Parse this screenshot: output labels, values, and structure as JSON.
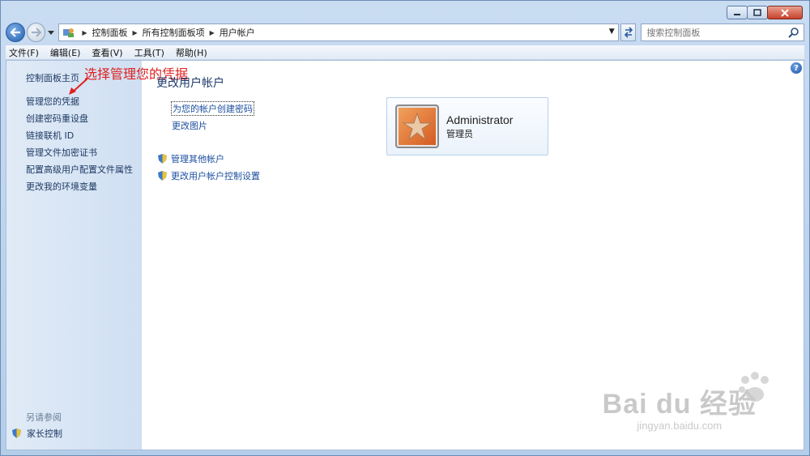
{
  "breadcrumb": [
    "控制面板",
    "所有控制面板项",
    "用户帐户"
  ],
  "search": {
    "placeholder": "搜索控制面板"
  },
  "menu": [
    "文件(F)",
    "编辑(E)",
    "查看(V)",
    "工具(T)",
    "帮助(H)"
  ],
  "sidebar": {
    "home": "控制面板主页",
    "links": [
      "管理您的凭据",
      "创建密码重设盘",
      "链接联机 ID",
      "管理文件加密证书",
      "配置高级用户配置文件属性",
      "更改我的环境变量"
    ],
    "see_also_title": "另请参阅",
    "see_also": [
      "家长控制"
    ]
  },
  "annotation": "选择管理您的凭据",
  "main": {
    "title": "更改用户帐户",
    "links": [
      "为您的帐户创建密码",
      "更改图片"
    ],
    "shield_links": [
      "管理其他帐户",
      "更改用户帐户控制设置"
    ]
  },
  "account": {
    "name": "Administrator",
    "role": "管理员"
  },
  "help": "?",
  "watermark": {
    "logo": "Bai du 经验",
    "sub": "jingyan.baidu.com"
  },
  "colors": {
    "link": "#1c4fa0",
    "annotation": "#e02020",
    "sidebar": "#d8e5f4"
  }
}
